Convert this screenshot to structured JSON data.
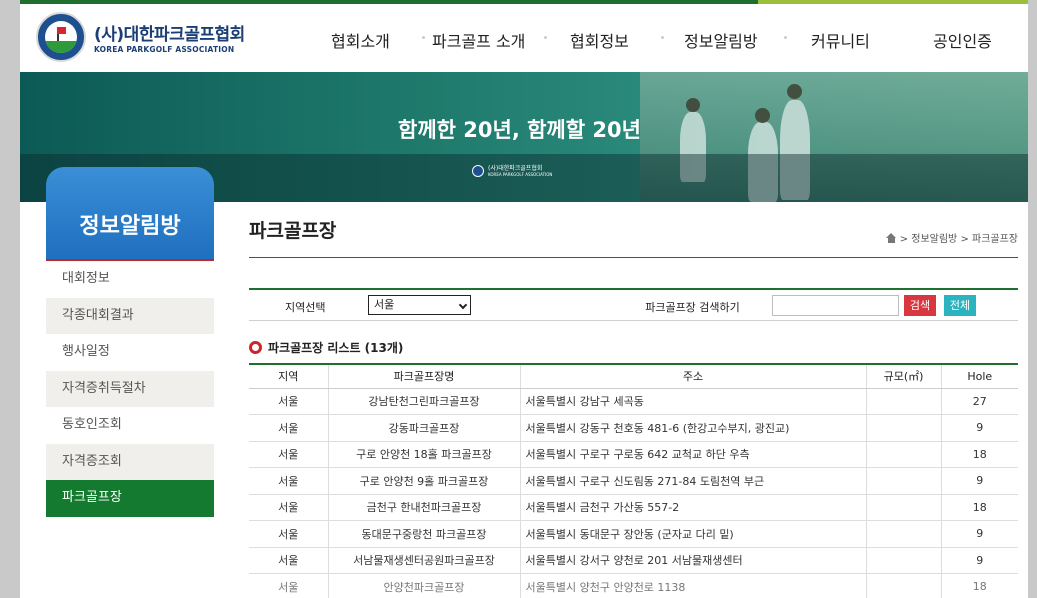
{
  "brand": {
    "name_kr": "(사)대한파크골프협회",
    "name_en": "KOREA PARKGOLF ASSOCIATION"
  },
  "nav": [
    {
      "label": "협회소개"
    },
    {
      "label": "파크골프 소개"
    },
    {
      "label": "협회정보"
    },
    {
      "label": "정보알림방"
    },
    {
      "label": "커뮤니티"
    },
    {
      "label": "공인인증"
    }
  ],
  "banner": {
    "title": "함께한 20년, 함께할 20년",
    "logo_kr": "(사)대한파크골프협회",
    "logo_en": "KOREA PARKGOLF ASSOCIATION"
  },
  "sidebar": {
    "title": "정보알림방",
    "items": [
      {
        "label": "대회정보"
      },
      {
        "label": "각종대회결과"
      },
      {
        "label": "행사일정"
      },
      {
        "label": "자격증취득절차"
      },
      {
        "label": "동호인조회"
      },
      {
        "label": "자격증조회"
      },
      {
        "label": "파크골프장"
      }
    ]
  },
  "page": {
    "title": "파크골프장",
    "breadcrumb": "> 정보알림방 > 파크골프장"
  },
  "search": {
    "region_label": "지역선택",
    "region_value": "서울",
    "keyword_label": "파크골프장 검색하기",
    "keyword_value": "",
    "search_button": "검색",
    "all_button": "전체"
  },
  "list": {
    "title": "파크골프장 리스트 (13개)",
    "columns": [
      "지역",
      "파크골프장명",
      "주소",
      "규모(㎡)",
      "Hole"
    ],
    "rows": [
      {
        "region": "서울",
        "name": "강남탄천그린파크골프장",
        "address": "서울특별시 강남구 세곡동",
        "size": "",
        "hole": "27"
      },
      {
        "region": "서울",
        "name": "강동파크골프장",
        "address": "서울특별시 강동구 천호동 481-6 (한강고수부지, 광진교)",
        "size": "",
        "hole": "9"
      },
      {
        "region": "서울",
        "name": "구로 안양천 18홀 파크골프장",
        "address": "서울특별시 구로구 구로동 642 교척교 하단 우측",
        "size": "",
        "hole": "18"
      },
      {
        "region": "서울",
        "name": "구로 안양천 9홀 파크골프장",
        "address": "서울특별시 구로구 신도림동 271-84 도림천역 부근",
        "size": "",
        "hole": "9"
      },
      {
        "region": "서울",
        "name": "금천구 한내천파크골프장",
        "address": "서울특별시 금천구 가산동 557-2",
        "size": "",
        "hole": "18"
      },
      {
        "region": "서울",
        "name": "동대문구중랑천 파크골프장",
        "address": "서울특별시 동대문구 장안동 (군자교 다리 밑)",
        "size": "",
        "hole": "9"
      },
      {
        "region": "서울",
        "name": "서남물재생센터공원파크골프장",
        "address": "서울특별시 강서구 양천로 201 서남물재생센터",
        "size": "",
        "hole": "9"
      },
      {
        "region": "서울",
        "name": "안양천파크골프장",
        "address": "서울특별시 양천구 안양천로 1138",
        "size": "",
        "hole": "18"
      }
    ]
  }
}
